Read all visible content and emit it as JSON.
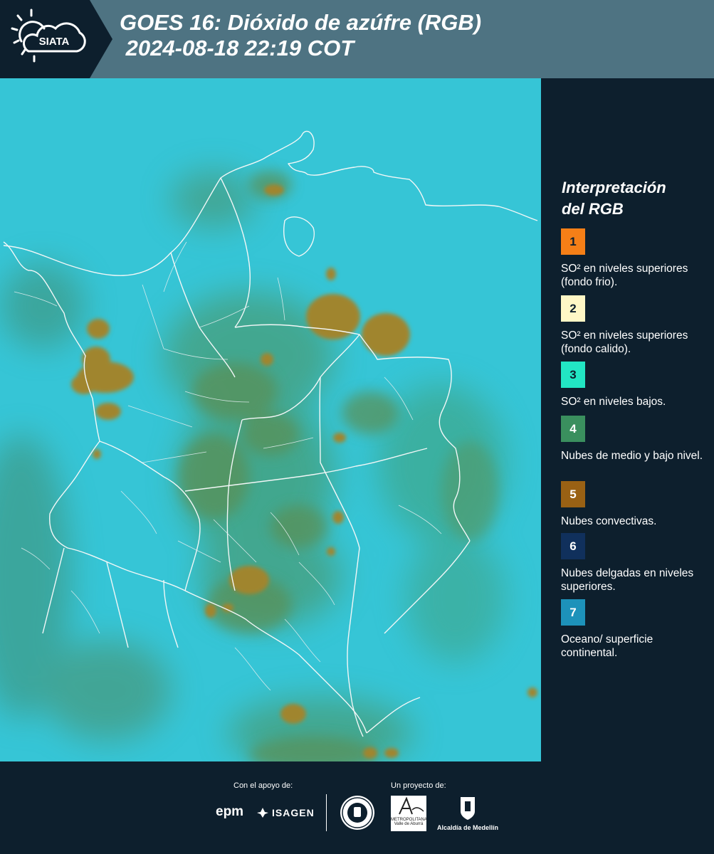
{
  "header": {
    "logo_text": "SIATA",
    "title_line1": "GOES 16: Dióxido de azúfre (RGB)",
    "title_line2": " 2024-08-18 22:19 COT"
  },
  "legend": {
    "title_line1": "Interpretación",
    "title_line2": "del RGB",
    "items": [
      {
        "number": "1",
        "color": "#f57f17",
        "text": "SO² en niveles superiores (fondo frio)."
      },
      {
        "number": "2",
        "color": "#fff7c6",
        "text": "SO² en niveles superiores (fondo calido)."
      },
      {
        "number": "3",
        "color": "#22e6c4",
        "text": "SO² en niveles bajos."
      },
      {
        "number": "4",
        "color": "#3a8f5e",
        "text": "Nubes de medio y bajo nivel."
      },
      {
        "number": "5",
        "color": "#996114",
        "text": "Nubes convectivas."
      },
      {
        "number": "6",
        "color": "#10305c",
        "text": "Nubes delgadas en niveles superiores."
      },
      {
        "number": "7",
        "color": "#1d92ba",
        "text": "Oceano/ superficie continental."
      }
    ]
  },
  "map": {
    "ocean_color": "#36c5d6",
    "convective_color": "#a0852f",
    "lowcloud_color": "#5a8f55"
  },
  "footer": {
    "support_label": "Con el apoyo de:",
    "project_label": "Un proyecto de:",
    "sponsor1": "epm",
    "sponsor2": "ISAGEN",
    "area_name": "METROPOLITANA Valle de Aburrá",
    "alcaldia_name": "Alcaldía de Medellín"
  }
}
